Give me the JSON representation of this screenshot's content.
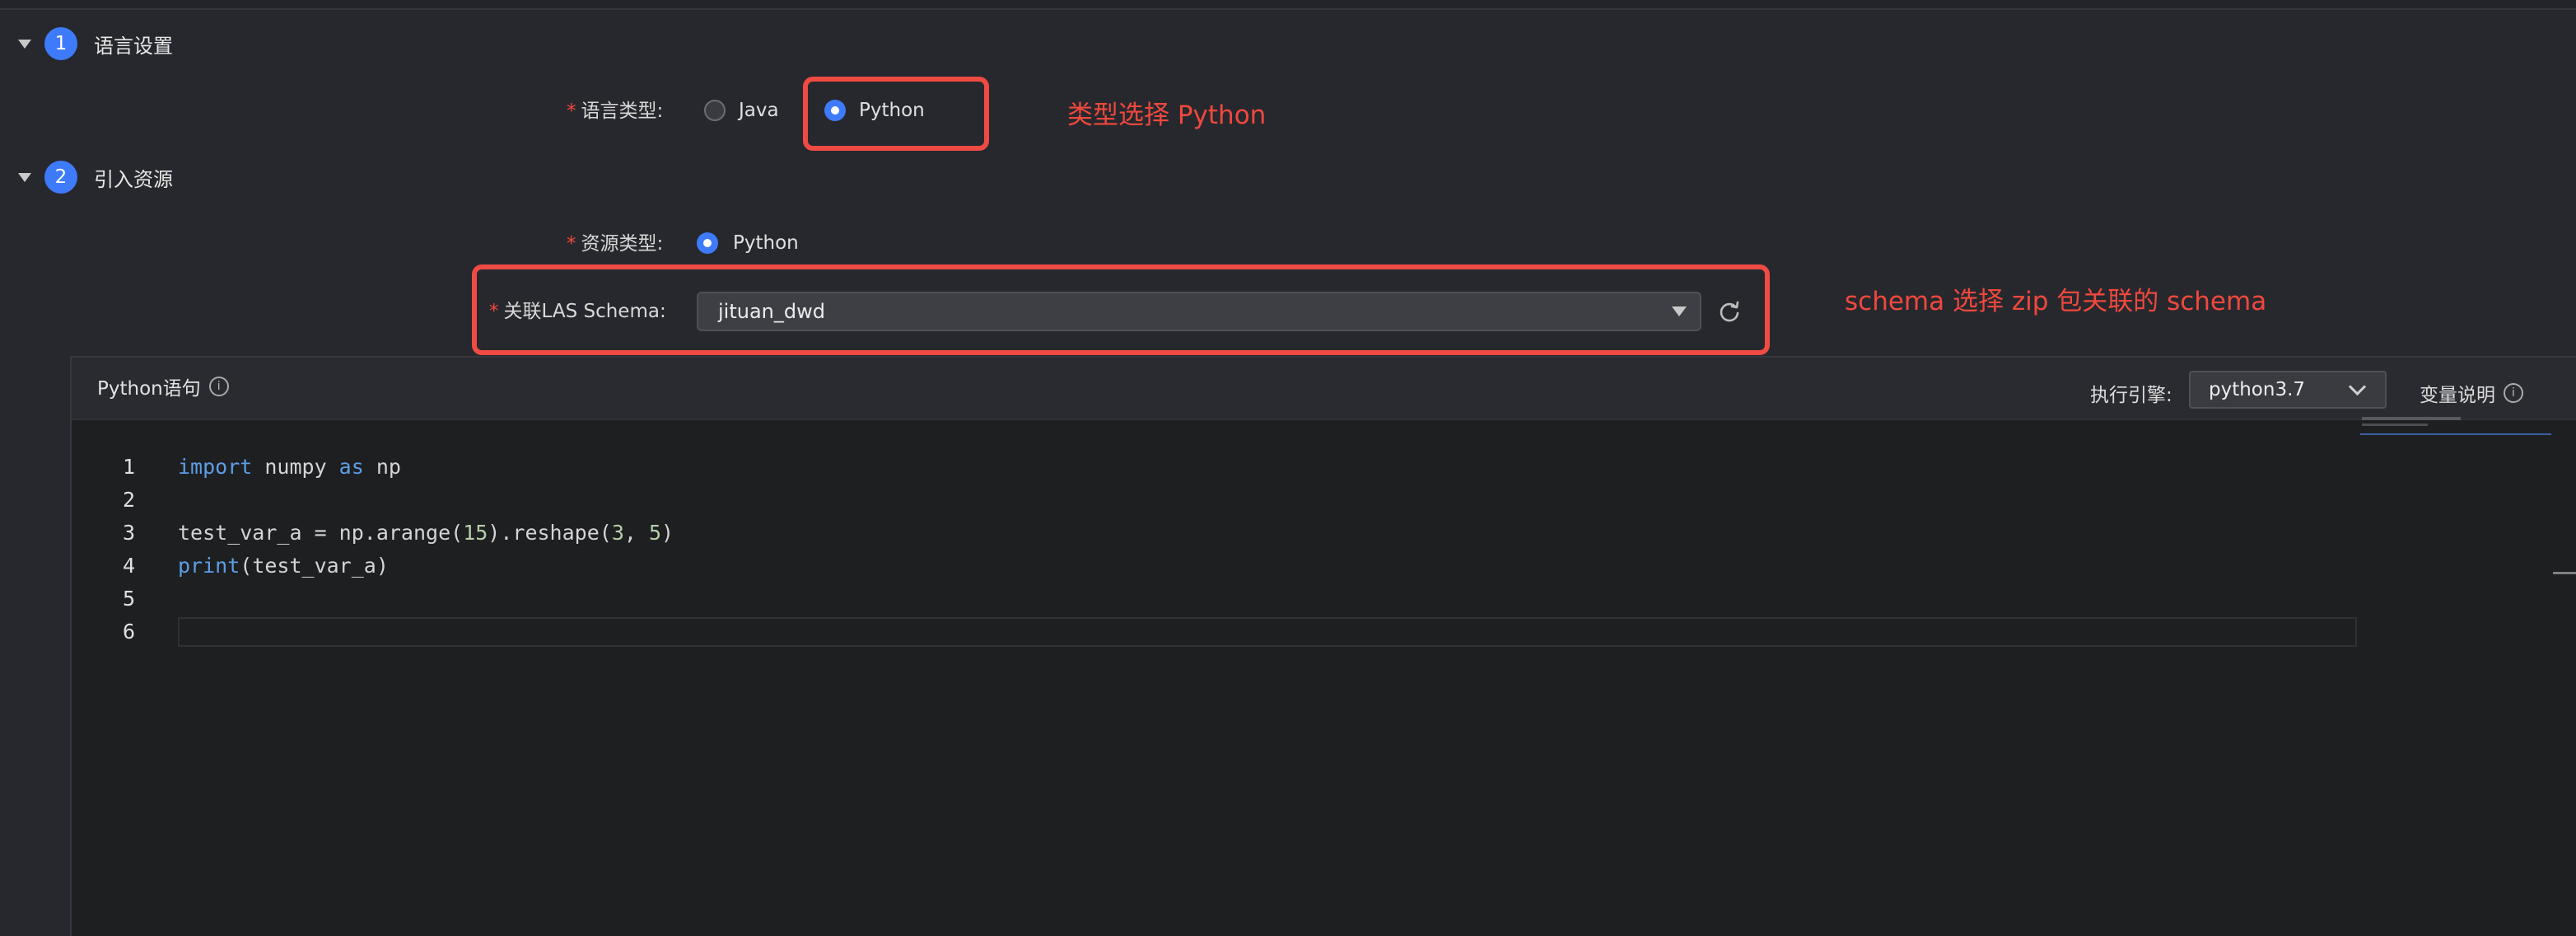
{
  "section1": {
    "number": "1",
    "title": "语言设置"
  },
  "language_type": {
    "required_mark": "*",
    "label": "语言类型:",
    "options": [
      {
        "label": "Java",
        "selected": false
      },
      {
        "label": "Python",
        "selected": true
      }
    ]
  },
  "annotation1": "类型选择 Python",
  "section2": {
    "number": "2",
    "title": "引入资源"
  },
  "resource_type": {
    "required_mark": "*",
    "label": "资源类型:",
    "option": {
      "label": "Python",
      "selected": true
    }
  },
  "las_schema": {
    "required_mark": "*",
    "label": "关联LAS Schema:",
    "value": "jituan_dwd"
  },
  "annotation2": "schema 选择 zip 包关联的 schema",
  "editor": {
    "title": "Python语句",
    "engine_label": "执行引擎:",
    "engine_value": "python3.7",
    "var_help": "变量说明",
    "line_numbers": [
      "1",
      "2",
      "3",
      "4",
      "5",
      "6"
    ],
    "code": {
      "l1": {
        "kw1": "import",
        "mid": " numpy ",
        "kw2": "as",
        "end": " np"
      },
      "l3": {
        "a": "test_var_a = np.arange(",
        "n1": "15",
        "b": ").reshape(",
        "n2": "3",
        "c": ", ",
        "n3": "5",
        "d": ")"
      },
      "l4": {
        "fn": "print",
        "rest": "(test_var_a)"
      }
    }
  },
  "colors": {
    "accent": "#3e7bfa",
    "annotation": "#f0483e",
    "background": "#27282d"
  },
  "icons": [
    "caret-down-icon",
    "refresh-icon",
    "info-icon",
    "chevron-down-icon"
  ]
}
